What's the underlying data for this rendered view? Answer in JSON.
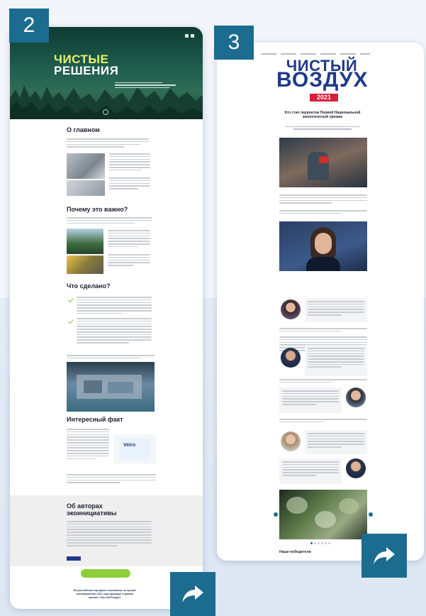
{
  "badges": {
    "first": "2",
    "second": "3"
  },
  "card1": {
    "hero_title_line1": "ЧИСТЫЕ",
    "hero_title_line2": "РЕШЕНИЯ",
    "section_about": "О главном",
    "section_why": "Почему это важно?",
    "section_done": "Что сделано?",
    "section_fact": "Интересный факт",
    "section_authors_line1": "Об авторах",
    "section_authors_line2": "экоинициативы",
    "footer_line1": "Всероссийская народная голосование за лучшие",
    "footer_line2": "экоинициативы 2021 года проходит в рамках",
    "footer_line3": "премии «Чистый Воздух»"
  },
  "card2": {
    "logo_line1": "ЧИСТЫЙ",
    "logo_line2": "ВОЗДУХ",
    "year": "2021",
    "headline_line1": "Кто стал лауреатом Первой Национальной",
    "headline_line2": "экологической премии",
    "bottom_title": "Наши победители"
  },
  "colors": {
    "badge": "#1b6c8f",
    "logo_blue": "#1f3a8a",
    "year_red": "#d81e3c",
    "hero_green": "#1d5a4b",
    "accent_yellow": "#e9f26a",
    "button_green": "#8bd03a"
  },
  "icons": {
    "share": "share-arrow-icon",
    "check": "checkmark-icon"
  }
}
